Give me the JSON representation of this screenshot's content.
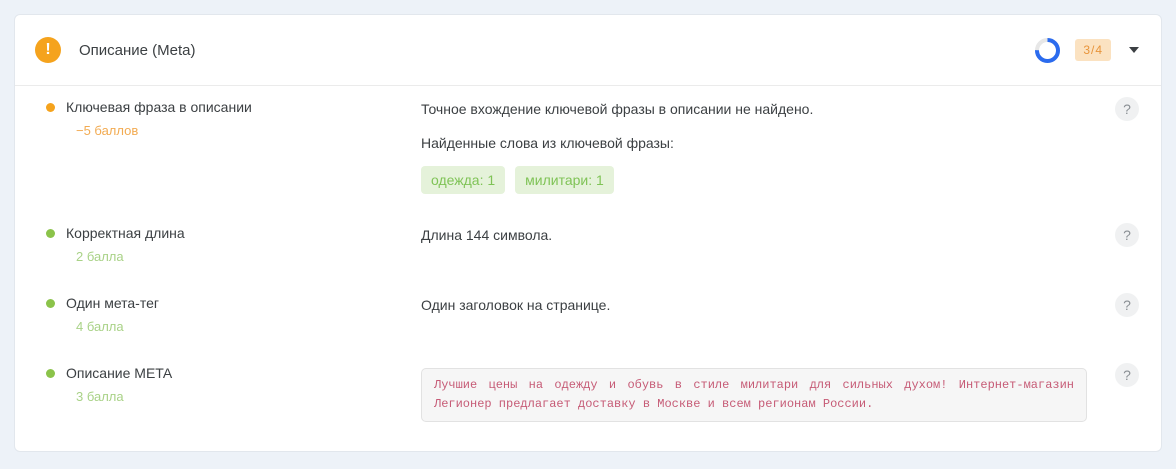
{
  "header": {
    "title": "Описание (Meta)",
    "score_badge": "3/4",
    "status": "warning"
  },
  "icons": {
    "warning_glyph": "!",
    "help_glyph": "?"
  },
  "colors": {
    "page_bg": "#edf2f8",
    "warning": "#f5a31d",
    "success": "#8bc34a",
    "badge_bg": "#fbe2c1",
    "badge_text": "#e8943a",
    "spinner_blue": "#2b6bee",
    "tag_bg": "#e5f2da",
    "tag_text": "#7fc356",
    "code_text": "#c65b76"
  },
  "rows": [
    {
      "status": "warning",
      "label": "Ключевая фраза в описании",
      "points": "−5 баллов",
      "line1": "Точное вхождение ключевой фразы в описании не найдено.",
      "line2": "Найденные слова из ключевой фразы:",
      "tags": [
        "одежда: 1",
        "милитари: 1"
      ]
    },
    {
      "status": "ok",
      "label": "Корректная длина",
      "points": "2 балла",
      "line1": "Длина 144 символа."
    },
    {
      "status": "ok",
      "label": "Один мета-тег",
      "points": "4 балла",
      "line1": "Один заголовок на странице."
    },
    {
      "status": "ok",
      "label": "Описание META",
      "points": "3 балла",
      "code": "Лучшие цены на одежду и обувь в стиле милитари для сильных духом! Интернет-магазин Легионер предлагает доставку в Москве и всем регионам России."
    }
  ]
}
